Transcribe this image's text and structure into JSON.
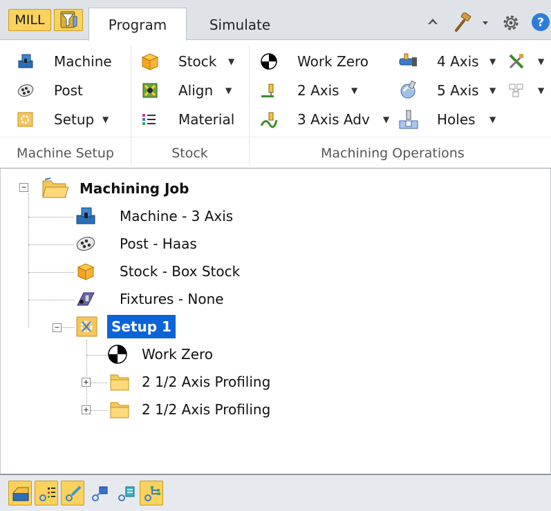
{
  "top_bar": {
    "mill_button": "MILL",
    "tabs": [
      {
        "label": "Program",
        "active": true
      },
      {
        "label": "Simulate",
        "active": false
      }
    ],
    "right_icons": [
      "caret-up-icon",
      "hammer-icon",
      "gear-icon",
      "help-icon"
    ]
  },
  "ribbon": {
    "groups": [
      {
        "label": "Machine Setup",
        "items": [
          {
            "label": "Machine",
            "icon": "machine-icon"
          },
          {
            "label": "Post",
            "icon": "post-icon"
          },
          {
            "label": "Setup",
            "icon": "setup-icon",
            "dropdown": true
          }
        ]
      },
      {
        "label": "Stock",
        "items": [
          {
            "label": "Stock",
            "icon": "stock-box-icon",
            "dropdown": true
          },
          {
            "label": "Align",
            "icon": "align-icon",
            "dropdown": true
          },
          {
            "label": "Material",
            "icon": "material-list-icon"
          }
        ]
      },
      {
        "label": "Machining Operations",
        "items": [
          {
            "label": "Work Zero",
            "icon": "work-zero-icon"
          },
          {
            "label": "2 Axis",
            "icon": "two-axis-icon",
            "dropdown": true
          },
          {
            "label": "3 Axis Adv",
            "icon": "three-axis-adv-icon",
            "dropdown": true
          },
          {
            "label": "4 Axis",
            "icon": "four-axis-icon",
            "dropdown": true
          },
          {
            "label": "5 Axis",
            "icon": "five-axis-icon",
            "dropdown": true
          },
          {
            "label": "Holes",
            "icon": "holes-icon",
            "dropdown": true
          }
        ]
      }
    ]
  },
  "tree": {
    "root": {
      "label": "Machining Job",
      "icon": "folder-open-icon"
    },
    "children": [
      {
        "label": "Machine - 3 Axis",
        "icon": "machine-icon"
      },
      {
        "label": "Post - Haas",
        "icon": "post-icon"
      },
      {
        "label": "Stock - Box Stock",
        "icon": "stock-box-icon"
      },
      {
        "label": "Fixtures - None",
        "icon": "fixtures-icon"
      }
    ],
    "setup": {
      "label": "Setup 1",
      "selected": true,
      "children": [
        {
          "label": "Work Zero",
          "icon": "work-zero-icon"
        },
        {
          "label": "2 1/2 Axis Profiling",
          "icon": "folder-icon"
        },
        {
          "label": "2 1/2 Axis Profiling",
          "icon": "folder-icon"
        }
      ]
    }
  },
  "bottom_toolbar": {
    "buttons": [
      "machine-setup-icon",
      "toolpath-list-icon",
      "toolpath-edit-icon",
      "toolpath-blue-icon",
      "toolpath-stats-icon",
      "setup-tree-icon"
    ]
  },
  "colors": {
    "accent_yellow": "#fbd25d",
    "selection_blue": "#0a64d6",
    "tab_strip": "#dfe3e8"
  }
}
